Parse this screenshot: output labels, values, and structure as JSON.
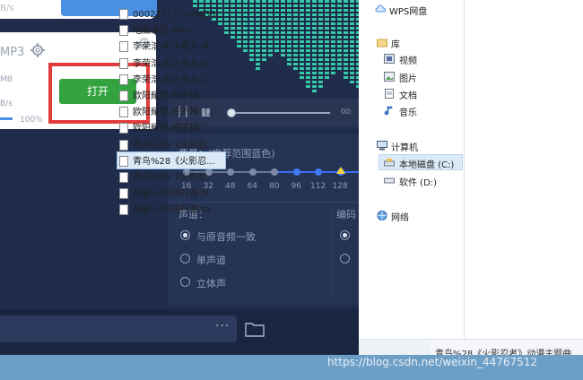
{
  "left_app": {
    "top_card_speed": "B/s",
    "format_label": "MP3",
    "size_unit": "MB",
    "speed_unit": "B/s",
    "progress_percent": "100%",
    "progress_fraction": 1.0,
    "open_button": "打开",
    "time_label": "00:",
    "quality_label": "质量：(推荐范围蓝色)",
    "quality_ticks": [
      "16",
      "32",
      "48",
      "64",
      "80",
      "96",
      "112",
      "128"
    ],
    "channel_label": "声道：",
    "channel_options": [
      "与原音频一致",
      "单声道",
      "立体声"
    ],
    "encoding_label": "编码",
    "input_dots": "···"
  },
  "explorer": {
    "nav": {
      "wps": "WPS网盘",
      "library": "库",
      "video": "视频",
      "pictures": "图片",
      "documents": "文档",
      "music": "音乐",
      "computer": "计算机",
      "local_disk": "本地磁盘 (C:)",
      "software_disk": "软件 (D:)",
      "network": "网络"
    },
    "files": [
      "000225172-00033...",
      "电脑录音.WAV",
      "李荣浩-年少有为.M...",
      "李荣浩-年少有为.M...",
      "李荣浩-年少有为-1...",
      "欧阳耀莹-戒不掉（...",
      "欧阳耀莹-戒不掉（...",
      "欧阳耀莹-戒不掉（...",
      "青鸟%28《火影忍...",
      "青鸟%28《火影忍...",
      "青鸟%28《火影忍...",
      "群星-小鸡进行曲.M...",
      "群星-小鸡进行曲.W..."
    ],
    "selected_index": 10,
    "status_text": "青鸟%28《火影忍者》动漫主题曲"
  },
  "watermark": "https://blog.csdn.net/weixin_44767512"
}
